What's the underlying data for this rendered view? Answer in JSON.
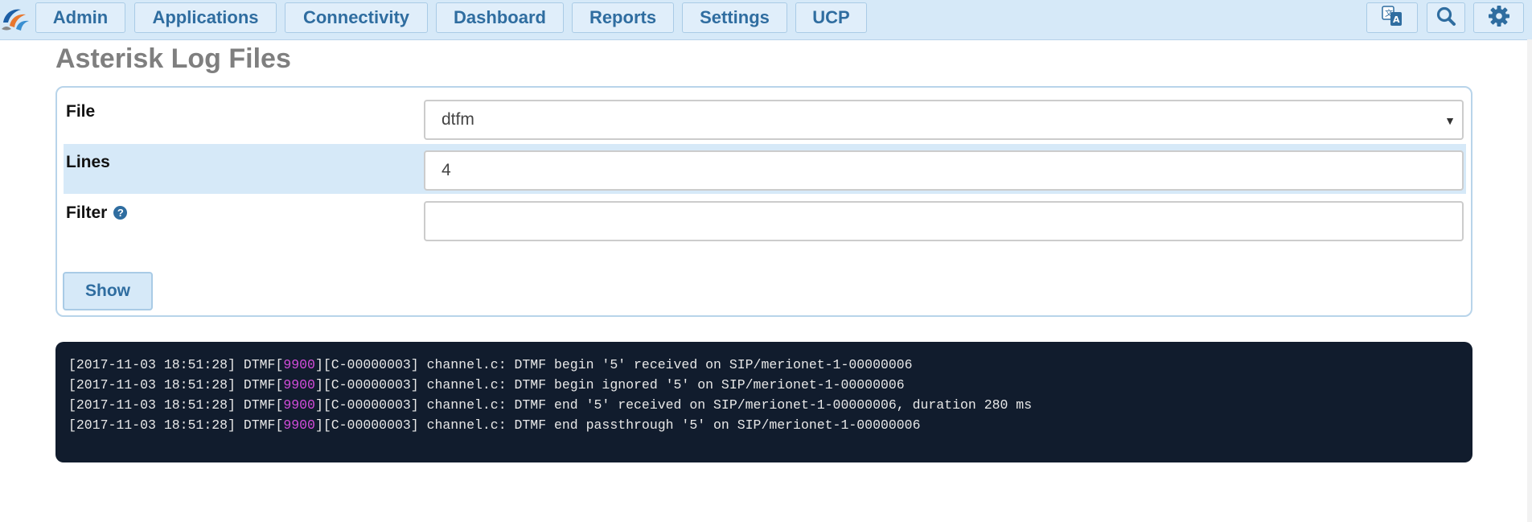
{
  "nav": {
    "items": [
      {
        "label": "Admin"
      },
      {
        "label": "Applications"
      },
      {
        "label": "Connectivity"
      },
      {
        "label": "Dashboard"
      },
      {
        "label": "Reports"
      },
      {
        "label": "Settings"
      },
      {
        "label": "UCP"
      }
    ],
    "icons": [
      "translate-icon",
      "search-icon",
      "gear-icon"
    ]
  },
  "page": {
    "title": "Asterisk Log Files"
  },
  "form": {
    "file_label": "File",
    "file_value": "dtfm",
    "lines_label": "Lines",
    "lines_value": "4",
    "filter_label": "Filter",
    "filter_value": "",
    "help_glyph": "?",
    "show_label": "Show"
  },
  "log": {
    "lines": [
      {
        "prefix": "[2017-11-03 18:51:28] DTMF[",
        "id": "9900",
        "rest": "][C-00000003] channel.c: DTMF begin '5' received on SIP/merionet-1-00000006"
      },
      {
        "prefix": "[2017-11-03 18:51:28] DTMF[",
        "id": "9900",
        "rest": "][C-00000003] channel.c: DTMF begin ignored '5' on SIP/merionet-1-00000006"
      },
      {
        "prefix": "[2017-11-03 18:51:28] DTMF[",
        "id": "9900",
        "rest": "][C-00000003] channel.c: DTMF end '5' received on SIP/merionet-1-00000006, duration 280 ms"
      },
      {
        "prefix": "[2017-11-03 18:51:28] DTMF[",
        "id": "9900",
        "rest": "][C-00000003] channel.c: DTMF end passthrough '5' on SIP/merionet-1-00000006"
      }
    ]
  },
  "colors": {
    "accent": "#2f6da0",
    "nav_bg": "#d6e9f8",
    "log_bg": "#111c2d",
    "log_highlight": "#d34cdb"
  }
}
